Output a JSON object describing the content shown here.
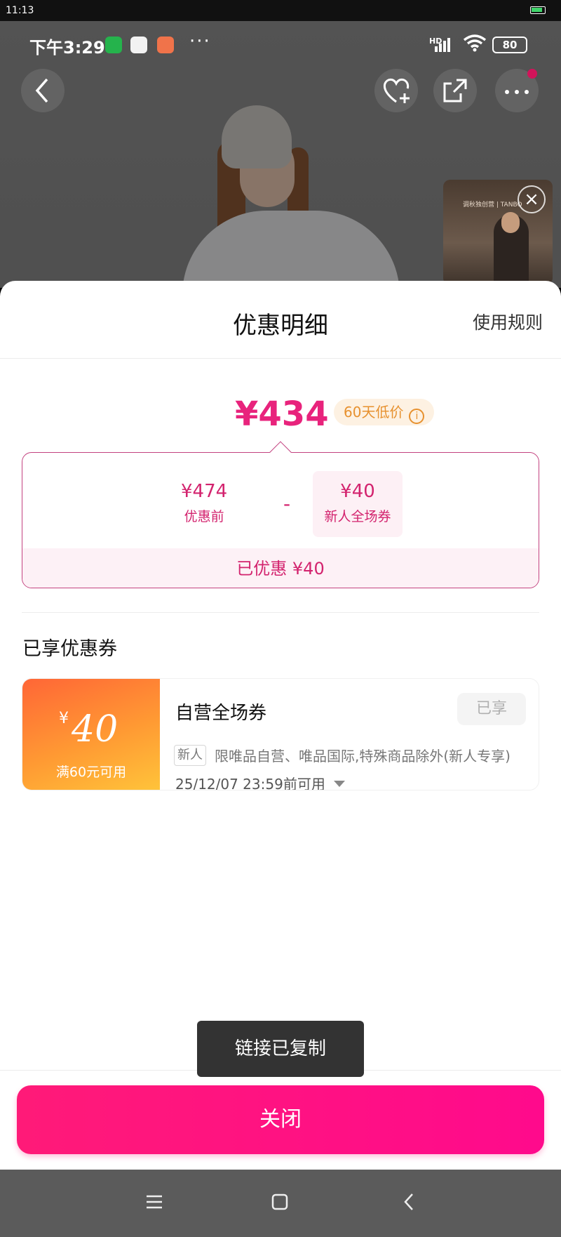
{
  "system_bar": {
    "time": "11:13"
  },
  "phone_status": {
    "time": "下午3:29",
    "network": "HD",
    "battery": "80",
    "more": "···"
  },
  "product_header": {
    "favorite_add": "add-to-favorites",
    "share": "share",
    "more": "more"
  },
  "video": {
    "caption": "调秋独创营 | TANBO"
  },
  "sheet": {
    "title": "优惠明细",
    "rules_link": "使用规则",
    "final_price": "¥434",
    "low_price_badge": "60天低价",
    "calc": {
      "original_amount": "¥474",
      "original_label": "优惠前",
      "minus": "-",
      "coupon_amount": "¥40",
      "coupon_label": "新人全场券",
      "saved_text": "已优惠 ¥40"
    },
    "section_title": "已享优惠券",
    "coupon": {
      "currency": "¥",
      "value": "40",
      "condition": "满60元可用",
      "name": "自营全场券",
      "status": "已享",
      "tag": "新人",
      "description": "限唯品自营、唯品国际,特殊商品除外(新人专享)",
      "expiry": "25/12/07 23:59前可用"
    },
    "toast": "链接已复制",
    "close_button": "关闭"
  },
  "colors": {
    "accent": "#e8237c",
    "button": "#ff1a78",
    "coupon_gradient_start": "#ff6636",
    "coupon_gradient_end": "#ffc43a"
  }
}
